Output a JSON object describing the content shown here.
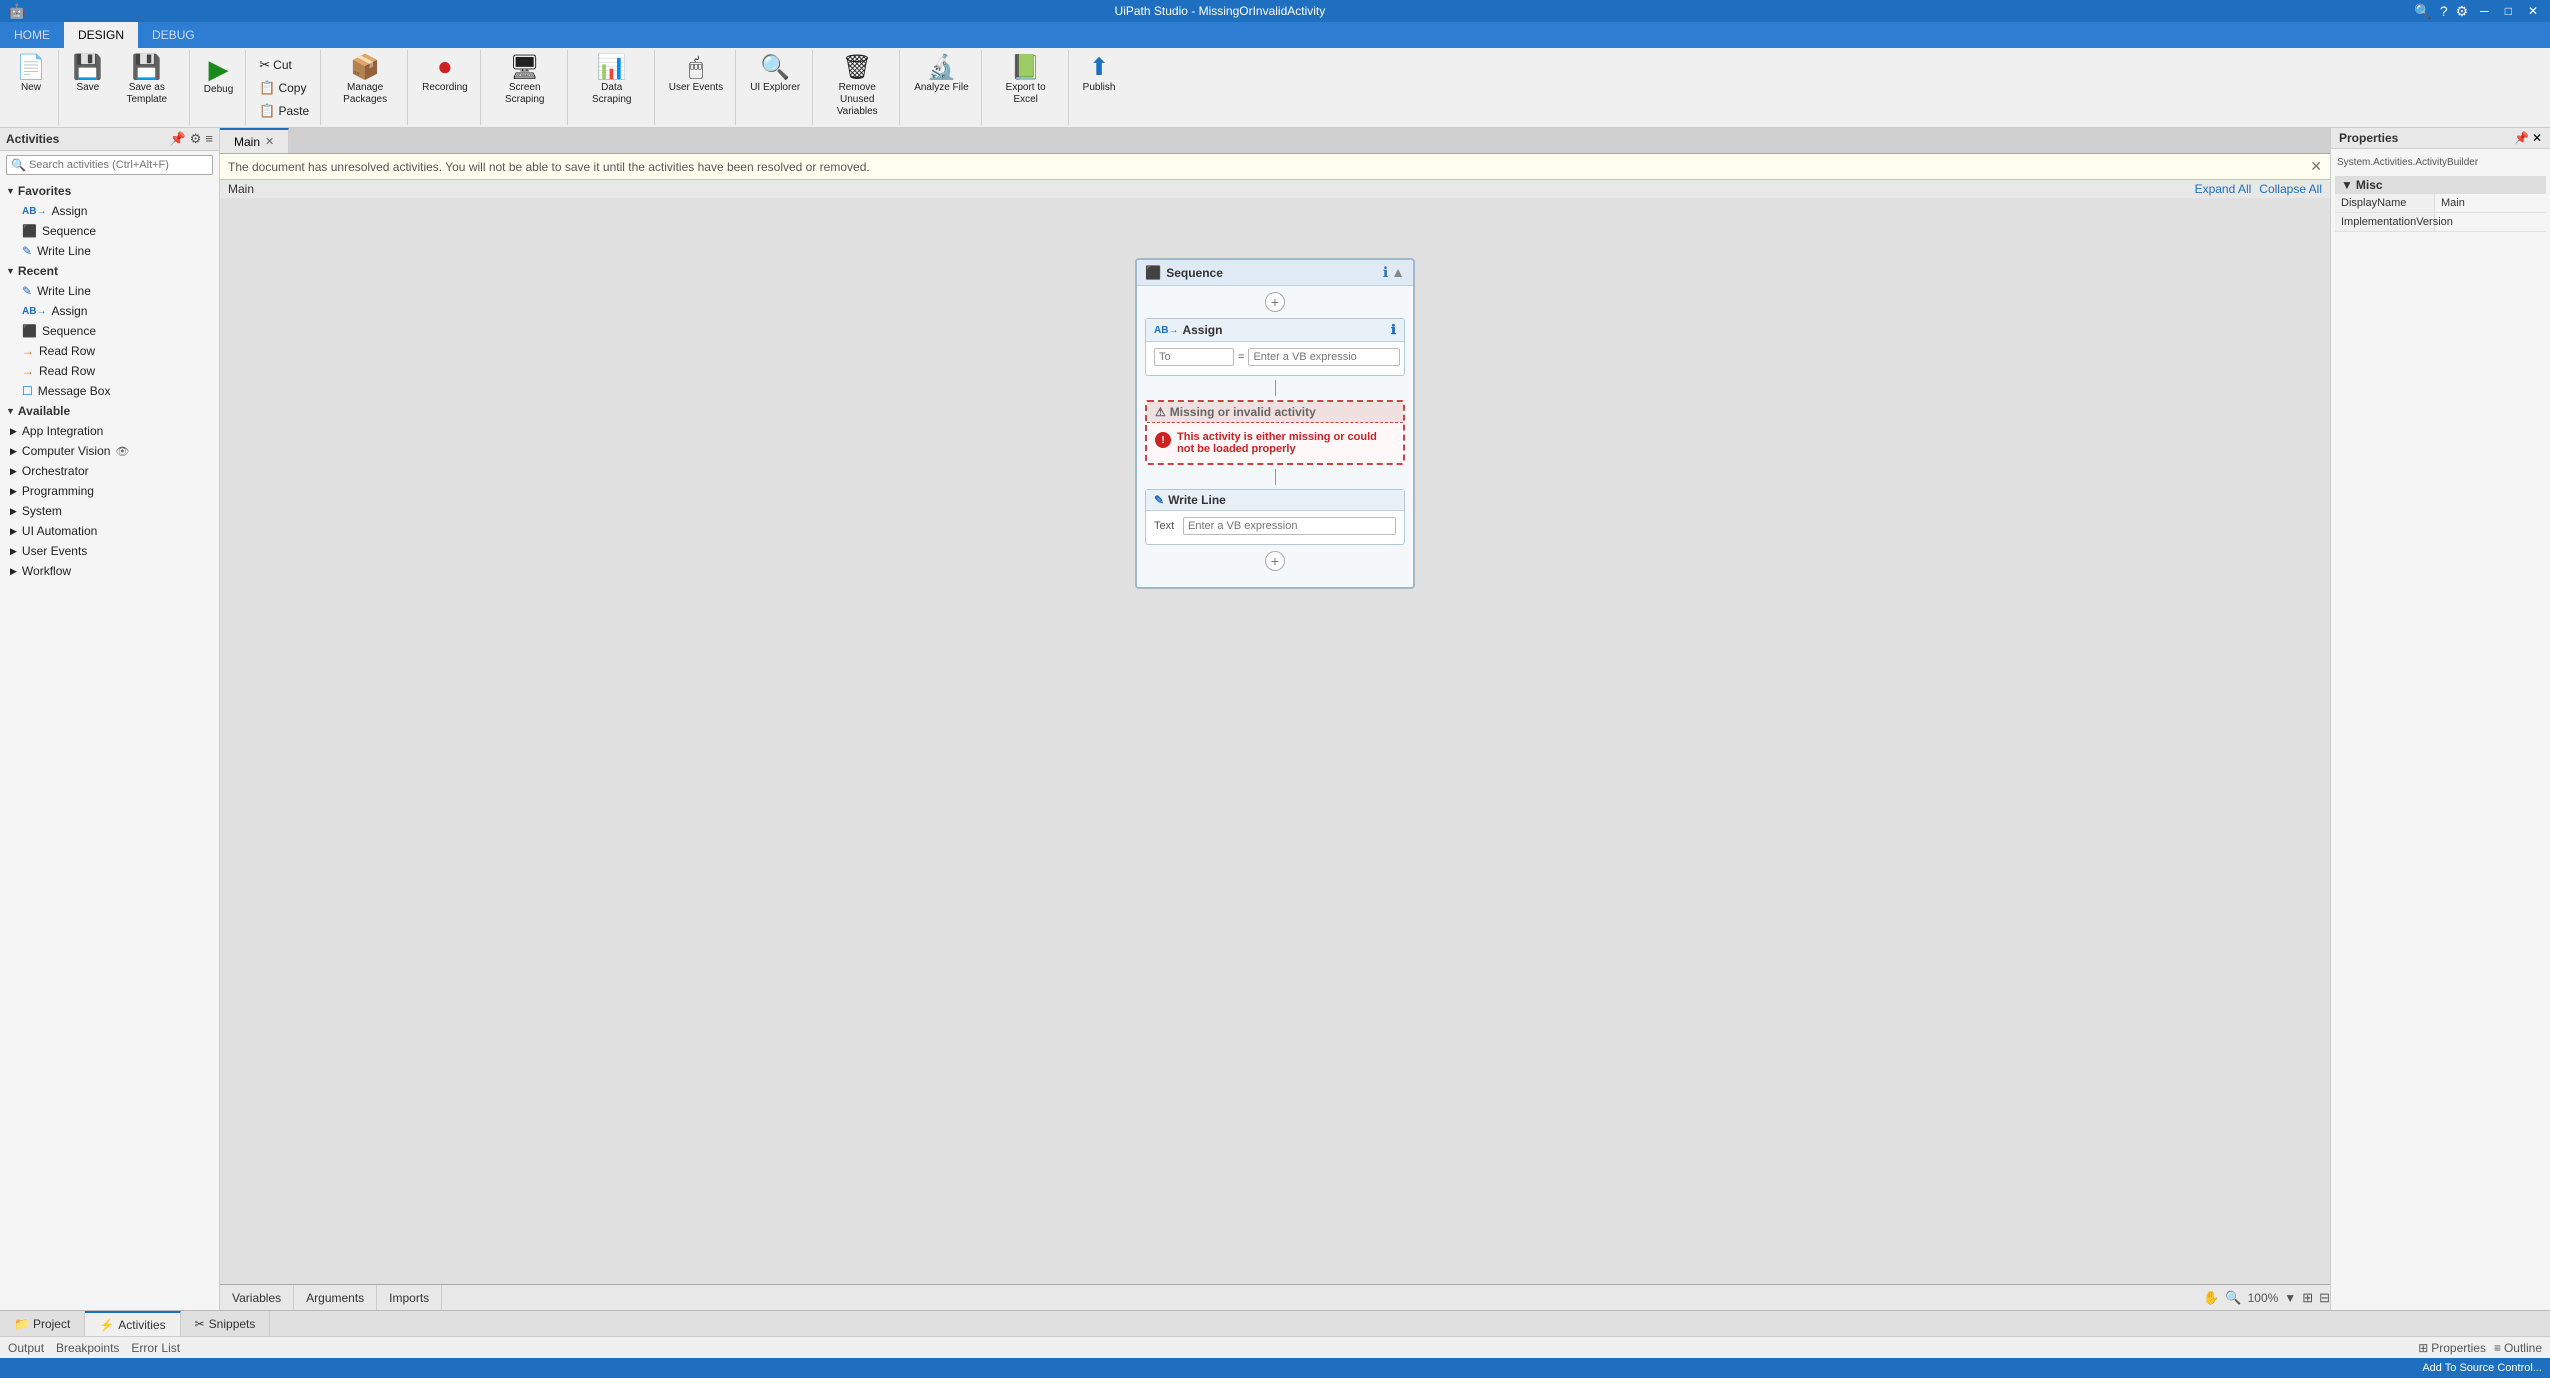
{
  "titlebar": {
    "title": "UiPath Studio - MissingOrInvalidActivity",
    "icons": [
      "search-icon",
      "help-icon",
      "settings-icon",
      "minimize-icon",
      "maximize-icon",
      "close-icon"
    ]
  },
  "nav": {
    "tabs": [
      {
        "label": "HOME",
        "active": false
      },
      {
        "label": "DESIGN",
        "active": true
      },
      {
        "label": "DEBUG",
        "active": false
      }
    ]
  },
  "ribbon": {
    "groups": [
      {
        "buttons": [
          {
            "label": "New",
            "icon": "📄",
            "name": "new-btn"
          }
        ]
      },
      {
        "buttons": [
          {
            "label": "Save",
            "icon": "💾",
            "name": "save-btn"
          },
          {
            "label": "Save as Template",
            "icon": "💾",
            "name": "save-as-template-btn"
          }
        ]
      },
      {
        "buttons": [
          {
            "label": "Debug",
            "icon": "▶",
            "name": "debug-btn"
          }
        ]
      },
      {
        "buttons": [
          {
            "label": "Cut",
            "icon": "✂",
            "name": "cut-btn"
          },
          {
            "label": "Copy",
            "icon": "📋",
            "name": "copy-btn"
          },
          {
            "label": "Paste",
            "icon": "📋",
            "name": "paste-btn"
          }
        ]
      },
      {
        "buttons": [
          {
            "label": "Manage Packages",
            "icon": "📦",
            "name": "manage-packages-btn"
          }
        ]
      },
      {
        "buttons": [
          {
            "label": "Recording",
            "icon": "⏺",
            "name": "recording-btn"
          }
        ]
      },
      {
        "buttons": [
          {
            "label": "Screen Scraping",
            "icon": "🖥",
            "name": "screen-scraping-btn"
          }
        ]
      },
      {
        "buttons": [
          {
            "label": "Data Scraping",
            "icon": "📊",
            "name": "data-scraping-btn"
          }
        ]
      },
      {
        "buttons": [
          {
            "label": "User Events",
            "icon": "🖱",
            "name": "user-events-btn"
          }
        ]
      },
      {
        "buttons": [
          {
            "label": "UI Explorer",
            "icon": "🔍",
            "name": "ui-explorer-btn"
          }
        ]
      },
      {
        "buttons": [
          {
            "label": "Remove Unused Variables",
            "icon": "🗑",
            "name": "remove-unused-variables-btn"
          }
        ]
      },
      {
        "buttons": [
          {
            "label": "Analyze File",
            "icon": "🔬",
            "name": "analyze-file-btn"
          }
        ]
      },
      {
        "buttons": [
          {
            "label": "Export to Excel",
            "icon": "📗",
            "name": "export-to-excel-btn"
          }
        ]
      },
      {
        "buttons": [
          {
            "label": "Publish",
            "icon": "🚀",
            "name": "publish-btn"
          }
        ]
      }
    ]
  },
  "activities_panel": {
    "title": "Activities",
    "search_placeholder": "Search activities (Ctrl+Alt+F)",
    "categories": [
      {
        "name": "Favorites",
        "expanded": true,
        "items": [
          {
            "label": "Assign",
            "icon": "AB"
          },
          {
            "label": "Sequence",
            "icon": "||"
          },
          {
            "label": "Write Line",
            "icon": "✎"
          }
        ]
      },
      {
        "name": "Recent",
        "expanded": true,
        "items": [
          {
            "label": "Write Line",
            "icon": "✎"
          },
          {
            "label": "Assign",
            "icon": "AB"
          },
          {
            "label": "Sequence",
            "icon": "||"
          },
          {
            "label": "Read Row",
            "icon": "→"
          },
          {
            "label": "Read Row",
            "icon": "→"
          },
          {
            "label": "Message Box",
            "icon": "☐"
          }
        ]
      },
      {
        "name": "Available",
        "expanded": true,
        "items": []
      },
      {
        "name": "App Integration",
        "expanded": false,
        "items": []
      },
      {
        "name": "Computer Vision",
        "expanded": false,
        "items": [],
        "has_eye": true
      },
      {
        "name": "Orchestrator",
        "expanded": false,
        "items": []
      },
      {
        "name": "Programming",
        "expanded": false,
        "items": []
      },
      {
        "name": "System",
        "expanded": false,
        "items": []
      },
      {
        "name": "UI Automation",
        "expanded": false,
        "items": []
      },
      {
        "name": "User Events",
        "expanded": false,
        "items": []
      },
      {
        "name": "Workflow",
        "expanded": false,
        "items": []
      }
    ]
  },
  "canvas": {
    "tab_label": "Main",
    "breadcrumb": "Main",
    "expand_all": "Expand All",
    "collapse_all": "Collapse All",
    "warning": "The document has unresolved activities. You will not be able to save it until the activities have been resolved or removed.",
    "sequence": {
      "title": "Sequence",
      "assign": {
        "title": "Assign",
        "to_placeholder": "To",
        "value_placeholder": "Enter a VB expressio"
      },
      "missing": {
        "title": "Missing or invalid activity",
        "error_text": "This activity is either missing or could not be loaded properly"
      },
      "write_line": {
        "title": "Write Line",
        "text_label": "Text",
        "text_placeholder": "Enter a VB expression"
      }
    }
  },
  "properties": {
    "title": "Properties",
    "class_name": "System.Activities.ActivityBuilder",
    "section_misc": "Misc",
    "fields": [
      {
        "key": "DisplayName",
        "value": "Main"
      },
      {
        "key": "ImplementationVersion",
        "value": ""
      }
    ]
  },
  "bottom_panel_tabs": [
    {
      "label": "Variables",
      "active": false
    },
    {
      "label": "Arguments",
      "active": false
    },
    {
      "label": "Imports",
      "active": false
    }
  ],
  "bottom_tabs": [
    {
      "label": "Project",
      "icon": "📁",
      "active": false
    },
    {
      "label": "Activities",
      "icon": "⚡",
      "active": true
    },
    {
      "label": "Snippets",
      "icon": "✂",
      "active": false
    }
  ],
  "status_bar": {
    "items": [
      "Output",
      "Breakpoints",
      "Error List"
    ],
    "zoom": "100%",
    "properties": "Properties",
    "outline": "Outline",
    "add_to_source": "Add To Source Control..."
  }
}
